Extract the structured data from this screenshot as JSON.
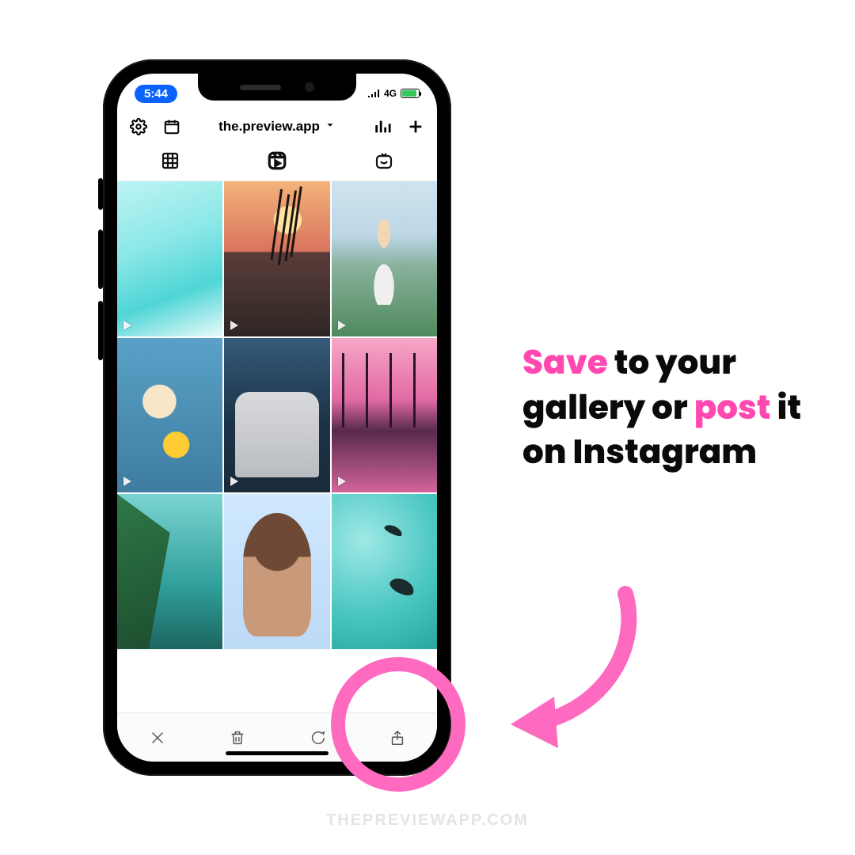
{
  "status": {
    "time": "5:44",
    "network": "4G"
  },
  "header": {
    "username": "the.preview.app"
  },
  "caption": {
    "w1": "Save",
    "w2": " to your gallery or ",
    "w3": "post",
    "w4": " it on Instagram"
  },
  "watermark": "THEPREVIEWAPP.COM",
  "colors": {
    "accent": "#ff48b0",
    "ring": "#ff6ac1",
    "timePill": "#0a63ff"
  }
}
